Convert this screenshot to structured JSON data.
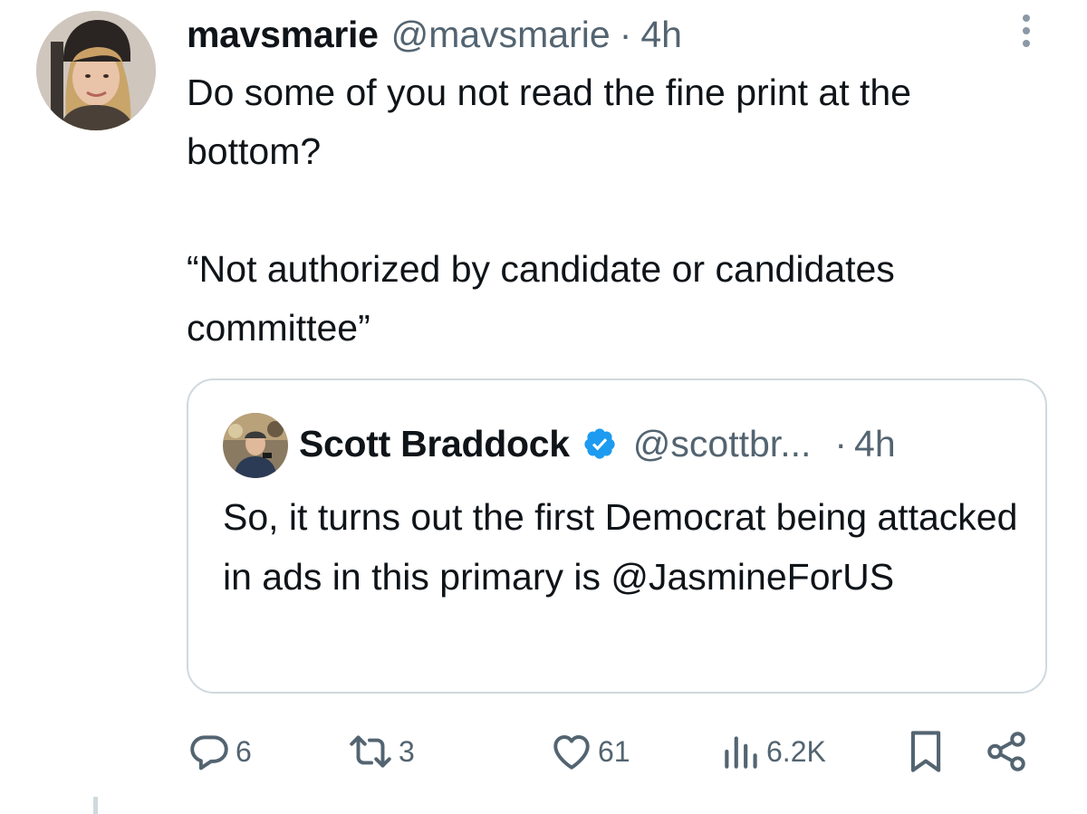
{
  "post": {
    "author_name": "mavsmarie",
    "author_handle": "@mavsmarie",
    "separator": "·",
    "time": "4h",
    "paragraphs": [
      "Do some of you not read the fine print at the bottom?",
      "“Not authorized by candidate or candidates committee”"
    ]
  },
  "quoted_post": {
    "author_name": "Scott Braddock",
    "verified": true,
    "author_handle": "@scottbr...",
    "separator": "·",
    "time": "4h",
    "text": "So, it turns out the first Democrat being attacked in ads in this primary is @JasmineForUS"
  },
  "actions": {
    "replies": "6",
    "reposts": "3",
    "likes": "61",
    "views": "6.2K"
  },
  "icons": {
    "more": "more-vertical-icon",
    "verified": "verified-badge-icon",
    "reply": "reply-icon",
    "repost": "repost-icon",
    "like": "heart-icon",
    "views": "views-icon",
    "bookmark": "bookmark-icon",
    "share": "share-icon"
  },
  "colors": {
    "text": "#0f1419",
    "secondary": "#536471",
    "verified": "#1d9bf0",
    "border": "#cfd9de"
  }
}
